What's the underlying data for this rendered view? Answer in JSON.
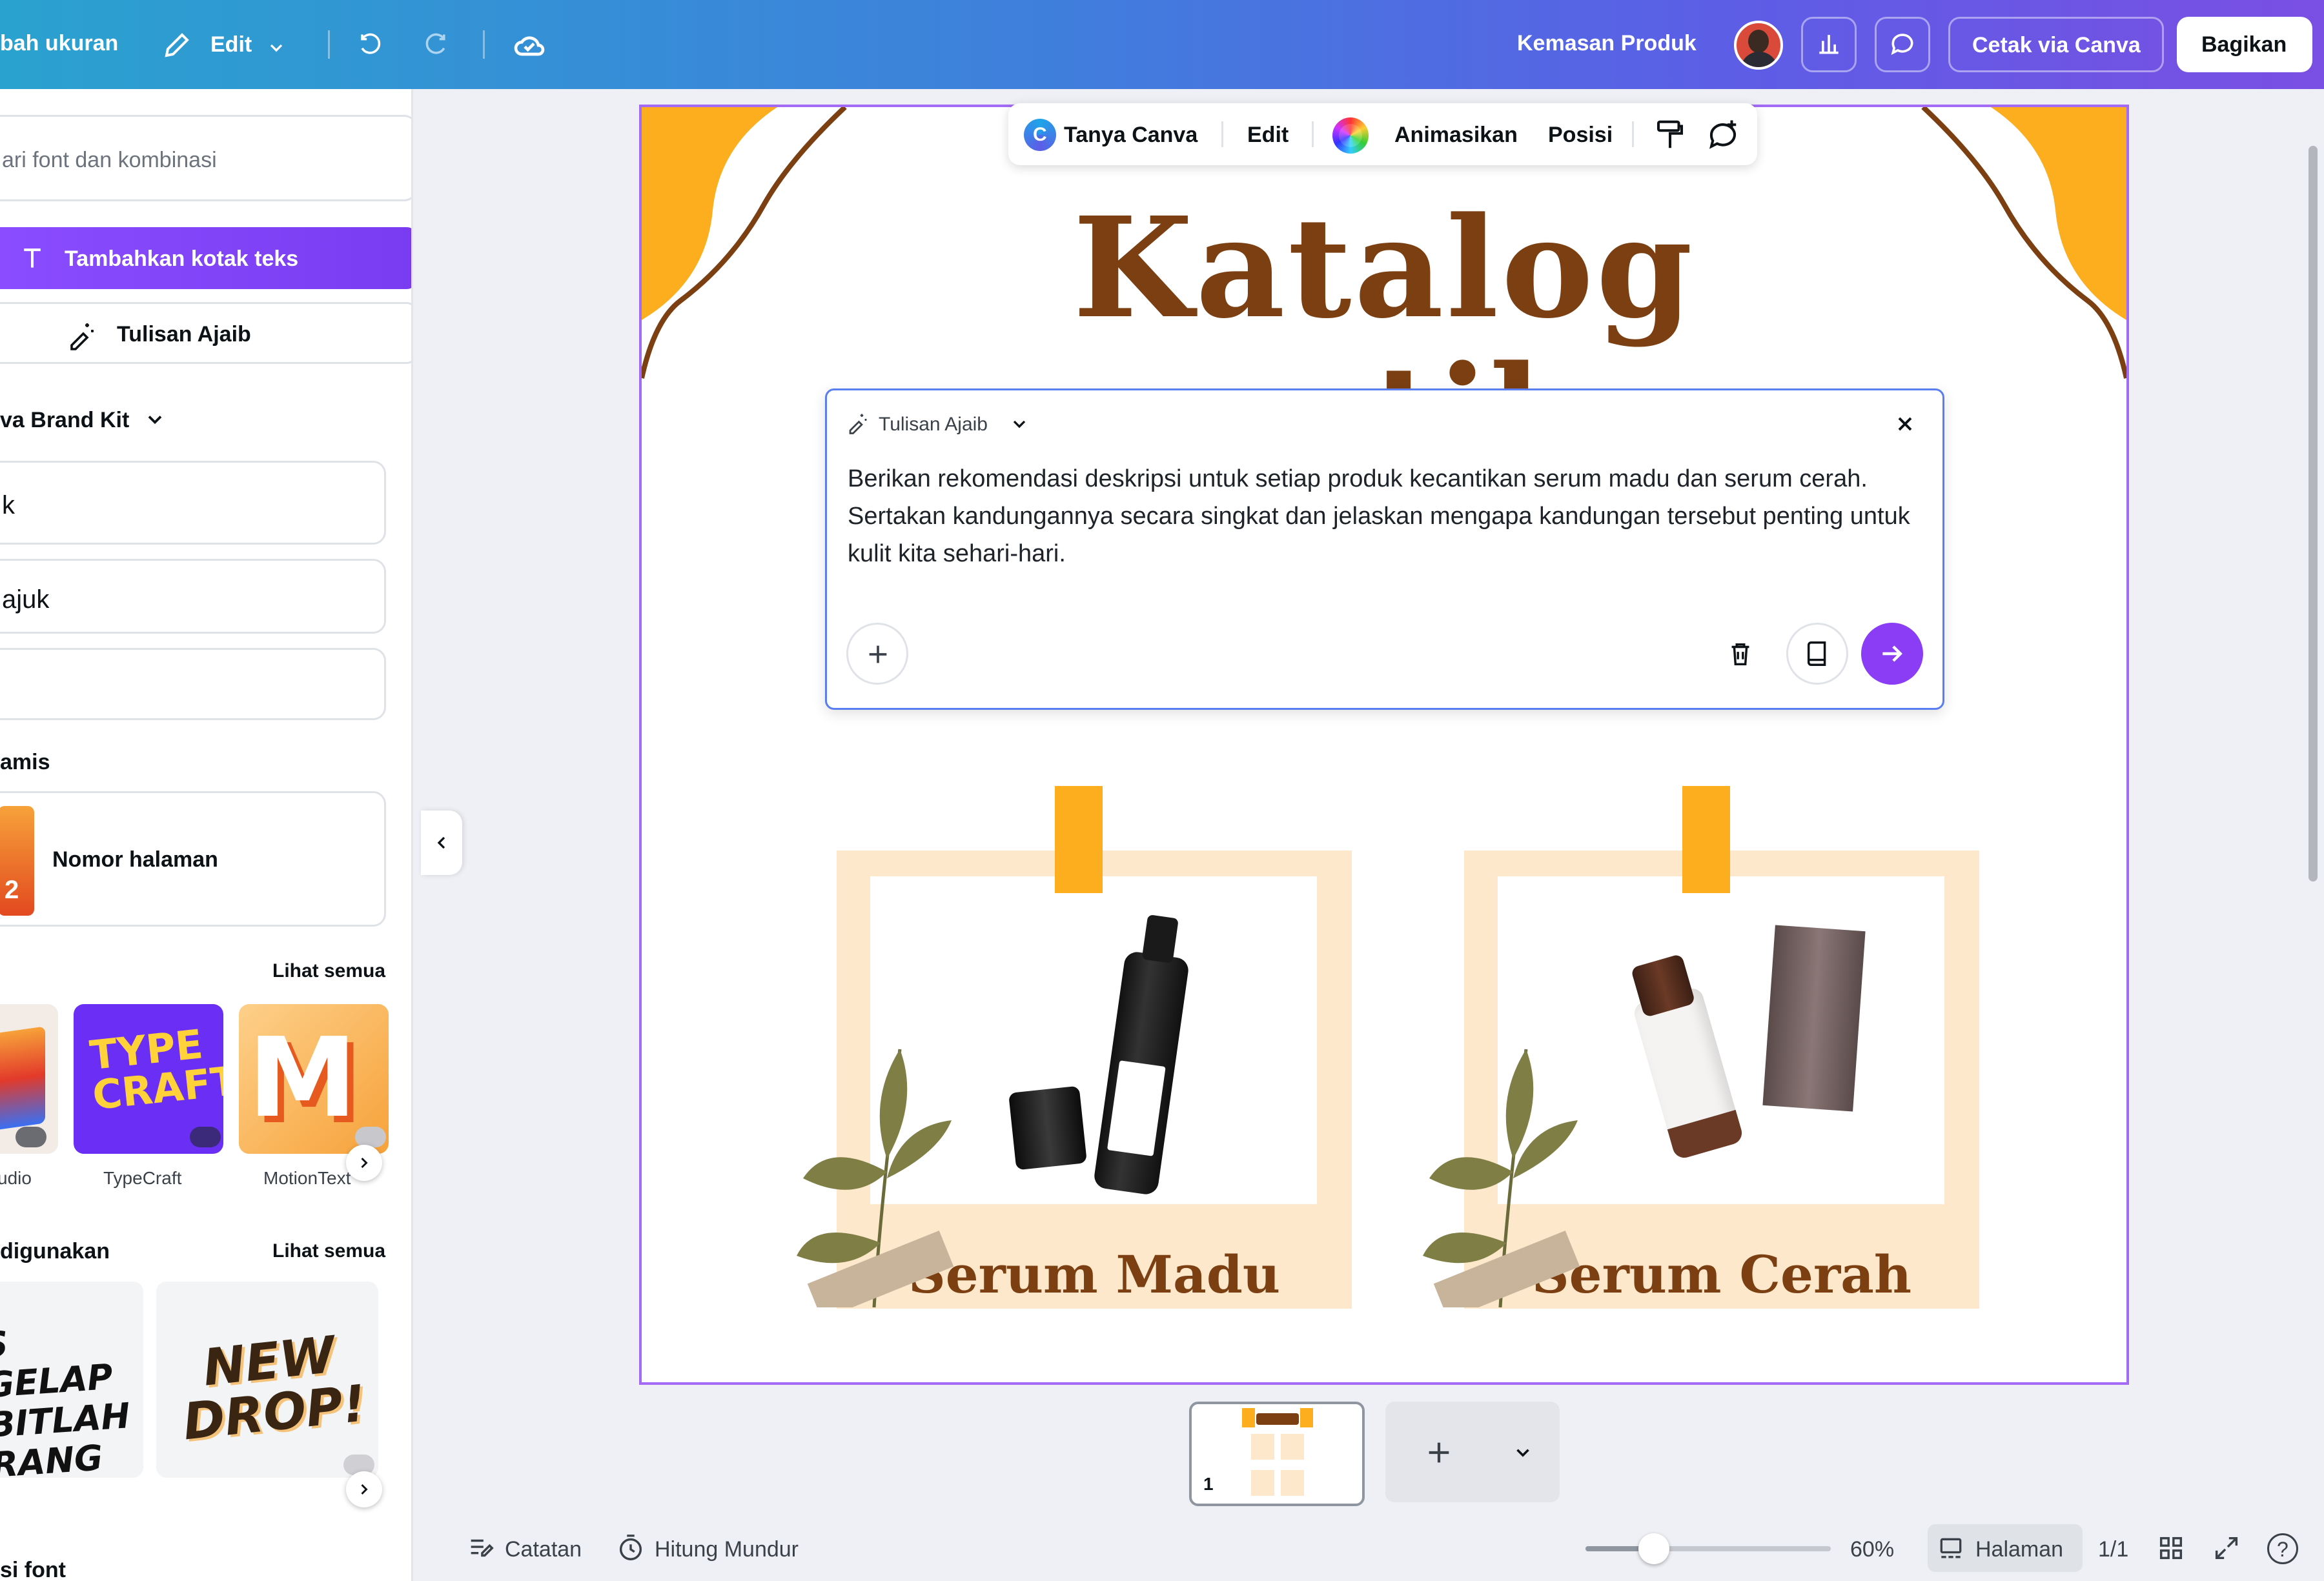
{
  "topbar": {
    "resize_label": "bah ukuran",
    "edit_label": "Edit",
    "doc_title": "Kemasan Produk",
    "print_label": "Cetak via Canva",
    "share_label": "Bagikan"
  },
  "left_panel": {
    "search_placeholder": "ari font dan kombinasi",
    "add_textbox_label": "Tambahkan kotak teks",
    "magic_write_label": "Tulisan Ajaib",
    "brand_kit_label": "va Brand Kit",
    "style_items": [
      "k",
      "ajuk",
      ""
    ],
    "dynamic_label": "amis",
    "page_number_label": "Nomor halaman",
    "page_number_thumb_text": "2",
    "see_all_1": "Lihat semua",
    "font_effects": [
      {
        "label": "udio",
        "color": "#f3ece6"
      },
      {
        "label": "TypeCraft",
        "color": "#6b2ef5"
      },
      {
        "label": "MotionText",
        "color": "#f7b03b"
      }
    ],
    "typecraft_thumb_text": "TYPE CRAFT",
    "motion_thumb_text": "M",
    "recent_label": "digunakan",
    "see_all_2": "Lihat semua",
    "recent_thumb_1": "S GELAP BITLAH RANG",
    "recent_thumb_2": "NEW DROP!",
    "bottom_label": "si font"
  },
  "element_toolbar": {
    "ask_canva": "Tanya Canva",
    "edit": "Edit",
    "animate": "Animasikan",
    "position": "Posisi"
  },
  "design": {
    "title_line1": "Katalog",
    "title_line2_partial": "antik",
    "product_1": "Serum Madu",
    "product_2": "Serum Cerah",
    "accent": "#7b3f12",
    "orange": "#fcae1e"
  },
  "magic_write": {
    "header": "Tulisan Ajaib",
    "prompt": "Berikan rekomendasi deskripsi untuk setiap produk kecantikan serum madu dan serum cerah. Sertakan kandungannya secara singkat dan jelaskan mengapa kandungan tersebut penting untuk kulit kita sehari-hari."
  },
  "pages": {
    "current_thumb_number": "1"
  },
  "bottombar": {
    "notes": "Catatan",
    "timer": "Hitung Mundur",
    "zoom": "60%",
    "zoom_fraction": 0.28,
    "pages_label": "Halaman",
    "page_count": "1/1",
    "help": "?"
  }
}
